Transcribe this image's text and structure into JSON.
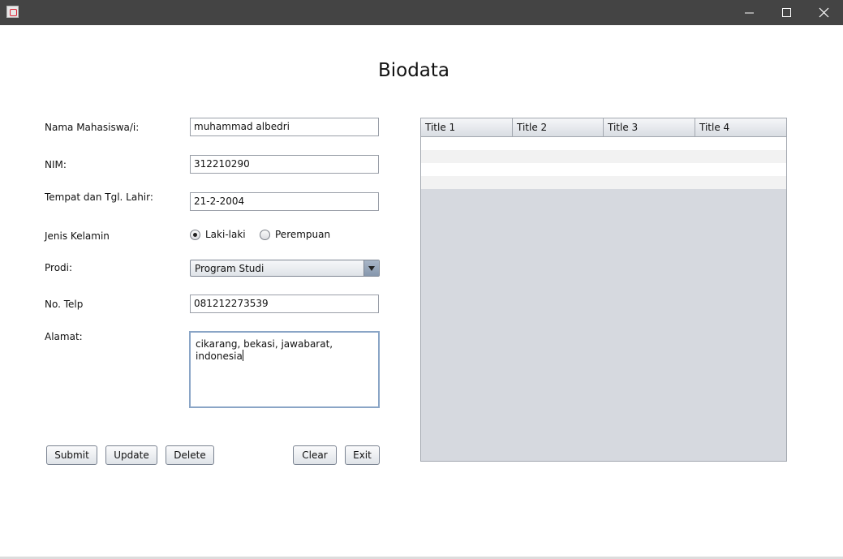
{
  "window": {
    "title": ""
  },
  "page_title": "Biodata",
  "form": {
    "nama": {
      "label": "Nama Mahasiswa/i:",
      "value": "muhammad albedri"
    },
    "nim": {
      "label": "NIM:",
      "value": "312210290"
    },
    "ttl": {
      "label": "Tempat dan Tgl. Lahir:",
      "value": "21-2-2004"
    },
    "jenis_kelamin": {
      "label": "Jenis Kelamin",
      "options": [
        {
          "label": "Laki-laki",
          "selected": true
        },
        {
          "label": "Perempuan",
          "selected": false
        }
      ]
    },
    "prodi": {
      "label": "Prodi:",
      "value": "Program Studi"
    },
    "telp": {
      "label": "No. Telp",
      "value": "081212273539"
    },
    "alamat": {
      "label": "Alamat:",
      "value": "cikarang, bekasi, jawabarat, indonesia"
    }
  },
  "buttons": {
    "submit": "Submit",
    "update": "Update",
    "delete": "Delete",
    "clear": "Clear",
    "exit": "Exit"
  },
  "table": {
    "columns": [
      "Title 1",
      "Title 2",
      "Title 3",
      "Title 4"
    ],
    "rows": [
      [
        "",
        "",
        "",
        ""
      ],
      [
        "",
        "",
        "",
        ""
      ],
      [
        "",
        "",
        "",
        ""
      ],
      [
        "",
        "",
        "",
        ""
      ]
    ]
  },
  "colors": {
    "titlebar": "#444444",
    "table_background": "#d6d9df",
    "row_alt": "#f2f2f2"
  }
}
